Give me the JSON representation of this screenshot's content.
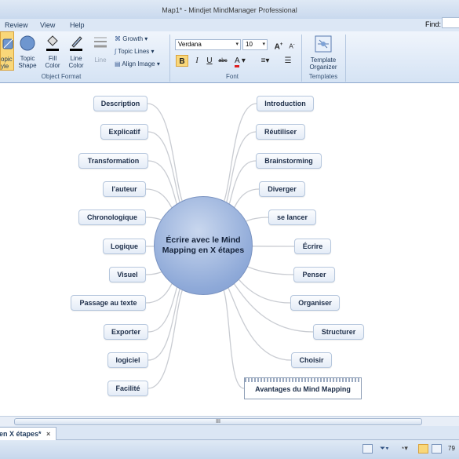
{
  "window": {
    "title": "Map1* - Mindjet MindManager Professional"
  },
  "menu": [
    "Review",
    "View",
    "Help"
  ],
  "find": {
    "label": "Find:"
  },
  "ribbon": {
    "topic_partial": "opic\nyle",
    "topic_shape": "Topic\nShape",
    "fill_color": "Fill\nColor",
    "line_color": "Line\nColor",
    "line": "Line",
    "growth": "Growth",
    "topic_lines": "Topic Lines",
    "align_image": "Align Image",
    "object_format": "Object Format",
    "font_name": "Verdana",
    "font_size": "10",
    "font_group": "Font",
    "template_organizer": "Template\nOrganizer",
    "templates": "Templates"
  },
  "map": {
    "central": "Écrire avec le Mind Mapping en X étapes",
    "left": [
      "Description",
      "Explicatif",
      "Transformation",
      "l'auteur",
      "Chronologique",
      "Logique",
      "Visuel",
      "Passage au texte",
      "Exporter",
      "logiciel",
      "Facilité"
    ],
    "right": [
      "Introduction",
      "Réutiliser",
      "Brainstorming",
      "Diverger",
      "se lancer",
      "Écrire",
      "Penser",
      "Organiser",
      "Structurer",
      "Choisir"
    ],
    "callout": "Avantages du Mind Mapping"
  },
  "scrollbar": {
    "grip": "III"
  },
  "tab": {
    "label": "en X étapes*",
    "close": "×"
  },
  "status": {
    "zoom": "79"
  }
}
